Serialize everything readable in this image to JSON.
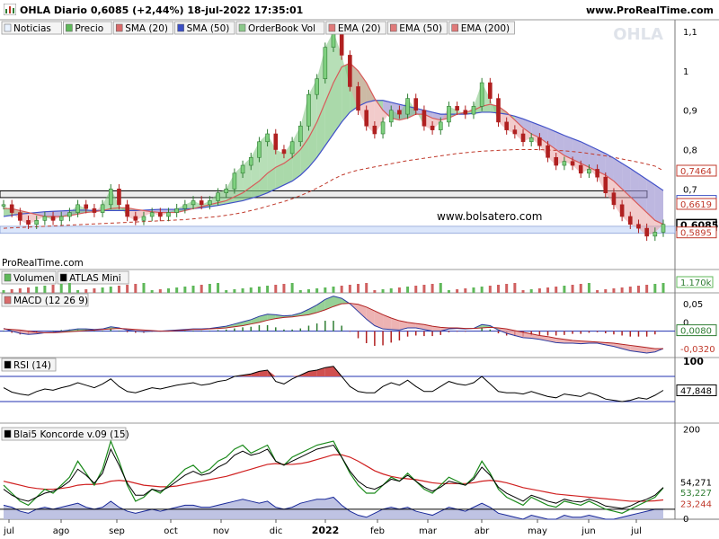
{
  "header": {
    "title": "OHLA Diario 0,6085 (+2,44%) 18-jul-2022 17:35:01",
    "brand": "www.ProRealTime.com"
  },
  "legend": {
    "items": [
      {
        "label": "Noticias",
        "color": "#e9f2ff"
      },
      {
        "label": "Precio",
        "color": "#5fb85a"
      },
      {
        "label": "SMA (20)",
        "color": "#d96b6b"
      },
      {
        "label": "SMA (50)",
        "color": "#3b4fc4"
      },
      {
        "label": "OrderBook Vol",
        "color": "#8bc88a"
      },
      {
        "label": "EMA (20)",
        "color": "#e07a7a"
      },
      {
        "label": "EMA (50)",
        "color": "#e07a7a"
      },
      {
        "label": "EMA (200)",
        "color": "#e07a7a"
      }
    ]
  },
  "watermark": "OHLA",
  "site_text": "www.bolsatero.com",
  "prt_text": "ProRealTime.com",
  "colors": {
    "up": "#2e7d32",
    "down": "#b02020",
    "sma20": "#d85a5a",
    "sma50": "#4050c8",
    "green_fill": "#7cc47c",
    "red_fill": "#e8a0a0",
    "purple_fill": "#9a90d0"
  },
  "chart_data": [
    {
      "type": "line",
      "panel": "price",
      "ylim": [
        0.55,
        1.13
      ],
      "y_ticks": [
        "1,1",
        "1",
        "0,9",
        "0,8",
        "0,7"
      ],
      "price_labels": [
        {
          "text": "0,7464",
          "value": 0.7464,
          "color": "#c0392b"
        },
        {
          "text": "0,6696",
          "value": 0.6696,
          "color": "#3b4fc4"
        },
        {
          "text": "0,6619",
          "value": 0.6619,
          "color": "#c0392b"
        },
        {
          "text": "0,6085",
          "value": 0.6085,
          "color": "#000000"
        },
        {
          "text": "0,5895",
          "value": 0.5895,
          "color": "#c0392b"
        }
      ],
      "x_labels": [
        "jul",
        "ago",
        "sep",
        "oct",
        "nov",
        "dic",
        "2022",
        "feb",
        "mar",
        "abr",
        "may",
        "jun",
        "jul"
      ],
      "close": [
        0.66,
        0.64,
        0.62,
        0.61,
        0.62,
        0.63,
        0.62,
        0.63,
        0.64,
        0.66,
        0.65,
        0.64,
        0.66,
        0.7,
        0.66,
        0.63,
        0.62,
        0.63,
        0.64,
        0.63,
        0.64,
        0.65,
        0.66,
        0.67,
        0.66,
        0.67,
        0.69,
        0.7,
        0.74,
        0.76,
        0.78,
        0.82,
        0.84,
        0.8,
        0.79,
        0.82,
        0.86,
        0.94,
        0.98,
        1.06,
        1.1,
        1.04,
        0.96,
        0.9,
        0.86,
        0.84,
        0.87,
        0.9,
        0.89,
        0.93,
        0.9,
        0.86,
        0.85,
        0.87,
        0.91,
        0.9,
        0.89,
        0.91,
        0.97,
        0.93,
        0.87,
        0.85,
        0.84,
        0.82,
        0.83,
        0.81,
        0.78,
        0.76,
        0.77,
        0.76,
        0.74,
        0.75,
        0.73,
        0.69,
        0.66,
        0.63,
        0.61,
        0.6,
        0.58,
        0.59,
        0.61
      ],
      "sma20": [
        0.65,
        0.65,
        0.645,
        0.64,
        0.635,
        0.63,
        0.63,
        0.63,
        0.632,
        0.636,
        0.64,
        0.642,
        0.645,
        0.65,
        0.652,
        0.652,
        0.648,
        0.645,
        0.642,
        0.64,
        0.64,
        0.64,
        0.645,
        0.65,
        0.655,
        0.66,
        0.665,
        0.67,
        0.68,
        0.69,
        0.705,
        0.72,
        0.74,
        0.755,
        0.765,
        0.78,
        0.8,
        0.83,
        0.87,
        0.92,
        0.97,
        1.01,
        1.02,
        1.0,
        0.97,
        0.93,
        0.9,
        0.88,
        0.875,
        0.88,
        0.89,
        0.89,
        0.88,
        0.875,
        0.88,
        0.89,
        0.895,
        0.9,
        0.91,
        0.915,
        0.91,
        0.895,
        0.875,
        0.855,
        0.84,
        0.83,
        0.815,
        0.8,
        0.785,
        0.775,
        0.765,
        0.755,
        0.745,
        0.735,
        0.72,
        0.7,
        0.68,
        0.66,
        0.64,
        0.62,
        0.61
      ],
      "sma50": [
        0.63,
        0.633,
        0.636,
        0.638,
        0.64,
        0.642,
        0.643,
        0.644,
        0.645,
        0.646,
        0.646,
        0.645,
        0.645,
        0.645,
        0.645,
        0.645,
        0.645,
        0.646,
        0.647,
        0.648,
        0.648,
        0.648,
        0.649,
        0.65,
        0.652,
        0.655,
        0.658,
        0.662,
        0.666,
        0.67,
        0.676,
        0.682,
        0.69,
        0.7,
        0.71,
        0.72,
        0.735,
        0.755,
        0.78,
        0.81,
        0.84,
        0.87,
        0.895,
        0.91,
        0.92,
        0.925,
        0.925,
        0.92,
        0.915,
        0.91,
        0.905,
        0.9,
        0.895,
        0.89,
        0.89,
        0.89,
        0.89,
        0.892,
        0.895,
        0.895,
        0.893,
        0.89,
        0.885,
        0.878,
        0.87,
        0.862,
        0.854,
        0.845,
        0.836,
        0.828,
        0.82,
        0.81,
        0.8,
        0.79,
        0.778,
        0.765,
        0.752,
        0.738,
        0.724,
        0.71,
        0.696
      ],
      "ema200": [
        0.6,
        0.601,
        0.602,
        0.603,
        0.604,
        0.605,
        0.606,
        0.607,
        0.608,
        0.609,
        0.61,
        0.611,
        0.612,
        0.613,
        0.614,
        0.615,
        0.616,
        0.617,
        0.618,
        0.619,
        0.62,
        0.621,
        0.622,
        0.624,
        0.626,
        0.628,
        0.63,
        0.633,
        0.636,
        0.64,
        0.645,
        0.65,
        0.656,
        0.662,
        0.668,
        0.675,
        0.683,
        0.692,
        0.702,
        0.713,
        0.725,
        0.735,
        0.742,
        0.748,
        0.752,
        0.756,
        0.76,
        0.764,
        0.768,
        0.772,
        0.775,
        0.778,
        0.781,
        0.784,
        0.787,
        0.79,
        0.792,
        0.794,
        0.796,
        0.797,
        0.798,
        0.799,
        0.8,
        0.8,
        0.8,
        0.8,
        0.799,
        0.798,
        0.797,
        0.795,
        0.793,
        0.79,
        0.787,
        0.784,
        0.78,
        0.776,
        0.772,
        0.768,
        0.763,
        0.758,
        0.7464
      ]
    },
    {
      "type": "bar",
      "panel": "volume",
      "legend": [
        "Volumen",
        "ATLAS Mini"
      ],
      "last_label": "1.170k"
    },
    {
      "type": "line",
      "panel": "macd",
      "title": "MACD (12 26 9)",
      "y_ticks": [
        "0,05",
        "0"
      ],
      "ylim": [
        -0.045,
        0.07
      ],
      "labels": [
        {
          "text": "0,0080",
          "color": "#2e7d32"
        },
        {
          "text": "-0,0320",
          "color": "#c0392b"
        }
      ],
      "macd": [
        0.005,
        0.0,
        -0.004,
        -0.006,
        -0.005,
        -0.003,
        -0.002,
        0.0,
        0.002,
        0.004,
        0.004,
        0.003,
        0.004,
        0.008,
        0.006,
        0.002,
        0.0,
        -0.001,
        0.0,
        0.0,
        0.001,
        0.002,
        0.003,
        0.004,
        0.004,
        0.005,
        0.007,
        0.009,
        0.013,
        0.017,
        0.021,
        0.027,
        0.031,
        0.03,
        0.028,
        0.029,
        0.033,
        0.04,
        0.048,
        0.058,
        0.064,
        0.06,
        0.05,
        0.036,
        0.022,
        0.01,
        0.004,
        0.003,
        0.002,
        0.006,
        0.006,
        0.003,
        0.0,
        0.0,
        0.004,
        0.005,
        0.004,
        0.005,
        0.012,
        0.01,
        0.002,
        -0.004,
        -0.008,
        -0.012,
        -0.013,
        -0.015,
        -0.018,
        -0.021,
        -0.022,
        -0.022,
        -0.023,
        -0.022,
        -0.022,
        -0.025,
        -0.028,
        -0.032,
        -0.036,
        -0.038,
        -0.04,
        -0.038,
        -0.032
      ],
      "signal": [
        0.004,
        0.003,
        0.002,
        0.0,
        -0.002,
        -0.003,
        -0.003,
        -0.002,
        -0.001,
        0.0,
        0.001,
        0.002,
        0.003,
        0.004,
        0.005,
        0.004,
        0.003,
        0.002,
        0.001,
        0.0,
        0.0,
        0.001,
        0.002,
        0.003,
        0.003,
        0.004,
        0.005,
        0.006,
        0.008,
        0.01,
        0.013,
        0.016,
        0.02,
        0.023,
        0.025,
        0.026,
        0.028,
        0.03,
        0.034,
        0.039,
        0.045,
        0.05,
        0.051,
        0.049,
        0.044,
        0.037,
        0.03,
        0.024,
        0.019,
        0.016,
        0.014,
        0.012,
        0.009,
        0.007,
        0.006,
        0.006,
        0.005,
        0.005,
        0.006,
        0.007,
        0.006,
        0.004,
        0.001,
        -0.002,
        -0.005,
        -0.008,
        -0.01,
        -0.013,
        -0.015,
        -0.017,
        -0.018,
        -0.019,
        -0.02,
        -0.021,
        -0.022,
        -0.024,
        -0.026,
        -0.028,
        -0.03,
        -0.032,
        -0.032
      ]
    },
    {
      "type": "line",
      "panel": "rsi",
      "title": "RSI (14)",
      "y_ticks": [
        "100"
      ],
      "ylim": [
        0,
        100
      ],
      "labels": [
        {
          "text": "47,848",
          "color": "#000000"
        }
      ],
      "values": [
        52,
        45,
        42,
        40,
        46,
        50,
        48,
        52,
        55,
        60,
        56,
        52,
        58,
        66,
        54,
        46,
        44,
        48,
        52,
        50,
        53,
        56,
        58,
        60,
        56,
        58,
        62,
        64,
        70,
        72,
        74,
        78,
        80,
        62,
        58,
        66,
        72,
        78,
        80,
        84,
        86,
        70,
        54,
        46,
        44,
        44,
        54,
        60,
        56,
        64,
        54,
        46,
        46,
        54,
        62,
        58,
        56,
        60,
        70,
        58,
        46,
        44,
        44,
        42,
        46,
        42,
        38,
        36,
        42,
        40,
        38,
        44,
        40,
        34,
        32,
        30,
        32,
        36,
        34,
        40,
        47.848
      ]
    },
    {
      "type": "line",
      "panel": "koncorde",
      "title": "Blai5 Koncorde v.09 (15)",
      "y_ticks": [
        "200",
        "0"
      ],
      "ylim": [
        -25,
        215
      ],
      "labels": [
        {
          "text": "54,271",
          "color": "#000000"
        },
        {
          "text": "53,227",
          "color": "#2e7d32"
        },
        {
          "text": "23,244",
          "color": "#c0392b"
        },
        {
          "text": "0",
          "color": "#0000aa"
        }
      ],
      "green": [
        60,
        40,
        20,
        10,
        30,
        50,
        40,
        60,
        80,
        120,
        90,
        60,
        100,
        170,
        120,
        60,
        20,
        30,
        50,
        40,
        60,
        80,
        100,
        110,
        90,
        100,
        120,
        130,
        150,
        160,
        140,
        150,
        160,
        120,
        110,
        130,
        140,
        150,
        160,
        165,
        170,
        130,
        90,
        60,
        40,
        40,
        60,
        80,
        70,
        90,
        70,
        50,
        40,
        60,
        80,
        70,
        60,
        80,
        120,
        90,
        50,
        30,
        20,
        10,
        30,
        20,
        10,
        5,
        20,
        15,
        10,
        20,
        10,
        0,
        -5,
        -10,
        0,
        10,
        20,
        30,
        53.227
      ],
      "black": [
        50,
        35,
        25,
        20,
        30,
        40,
        45,
        55,
        70,
        100,
        85,
        65,
        90,
        150,
        110,
        65,
        35,
        35,
        50,
        45,
        55,
        70,
        85,
        95,
        85,
        90,
        105,
        115,
        135,
        145,
        135,
        140,
        150,
        120,
        110,
        120,
        130,
        140,
        150,
        155,
        160,
        130,
        95,
        70,
        55,
        50,
        60,
        75,
        70,
        85,
        70,
        55,
        45,
        55,
        70,
        65,
        60,
        75,
        105,
        85,
        55,
        40,
        30,
        20,
        35,
        28,
        20,
        15,
        25,
        20,
        18,
        25,
        18,
        8,
        5,
        2,
        8,
        18,
        25,
        35,
        54.271
      ],
      "red": [
        70,
        65,
        60,
        55,
        52,
        50,
        50,
        52,
        55,
        60,
        62,
        62,
        64,
        70,
        72,
        70,
        65,
        60,
        58,
        56,
        56,
        58,
        62,
        66,
        70,
        74,
        78,
        82,
        88,
        94,
        100,
        106,
        112,
        114,
        112,
        112,
        114,
        118,
        124,
        130,
        136,
        136,
        130,
        120,
        108,
        96,
        88,
        82,
        78,
        76,
        74,
        70,
        66,
        64,
        64,
        64,
        64,
        66,
        70,
        72,
        70,
        66,
        60,
        54,
        50,
        46,
        42,
        38,
        36,
        34,
        32,
        30,
        28,
        26,
        24,
        22,
        20,
        20,
        20,
        21,
        23.244
      ],
      "blue": [
        10,
        5,
        -5,
        -10,
        0,
        5,
        0,
        5,
        10,
        15,
        5,
        0,
        5,
        20,
        5,
        -5,
        -10,
        -5,
        0,
        -5,
        0,
        5,
        10,
        10,
        5,
        5,
        10,
        15,
        20,
        25,
        20,
        15,
        20,
        5,
        0,
        5,
        15,
        20,
        25,
        25,
        30,
        10,
        -5,
        -15,
        -20,
        -10,
        0,
        5,
        0,
        5,
        -5,
        -10,
        -15,
        -5,
        5,
        0,
        -5,
        5,
        15,
        5,
        -10,
        -15,
        -20,
        -25,
        -15,
        -20,
        -25,
        -25,
        -15,
        -20,
        -20,
        -15,
        -20,
        -25,
        -25,
        -20,
        -15,
        -10,
        -5,
        0,
        0
      ]
    }
  ]
}
